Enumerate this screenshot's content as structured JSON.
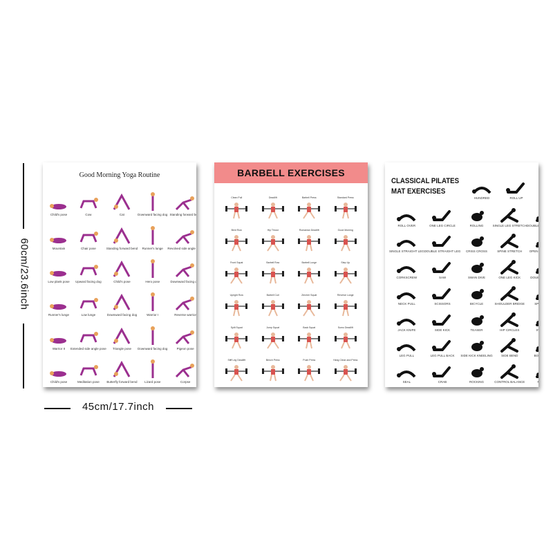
{
  "dimensions": {
    "height_label": "60cm/23.6inch",
    "width_label": "45cm/17.7inch"
  },
  "colors": {
    "yoga_accent": "#9b2f8f",
    "yoga_skin": "#e8a15a",
    "barbell_banner": "#f28b8b",
    "barbell_figure": "#d9534f",
    "pilates_silhouette": "#111111"
  },
  "posters": {
    "yoga": {
      "title": "Good Morning Yoga Routine",
      "rows": [
        [
          "Child's pose",
          "Cow",
          "Cat",
          "Downward facing dog",
          "Standing forward bend"
        ],
        [
          "Mountain",
          "Chair pose",
          "Standing forward bend",
          "Runner's lunge",
          "Revolved side angle pose"
        ],
        [
          "Low plank pose",
          "Upward facing dog",
          "Child's pose",
          "Hero pose",
          "Downward facing dog"
        ],
        [
          "Runner's lunge",
          "Low lunge",
          "Downward facing dog",
          "Warrior I",
          "Reverse warrior"
        ],
        [
          "Warrior II",
          "Extended side angle pose",
          "Triangle pose",
          "Downward facing dog",
          "Pigeon pose"
        ],
        [
          "Child's pose",
          "Meditation pose",
          "Butterfly forward bend",
          "Lizard pose",
          "Corpse"
        ]
      ]
    },
    "barbell": {
      "title": "BARBELL EXERCISES",
      "rows": [
        [
          "Clean Pull",
          "Deadlift",
          "Barbell Press",
          "Standard Press"
        ],
        [
          "Bent Row",
          "Hip Thrust",
          "Romanian Deadlift",
          "Good Morning"
        ],
        [
          "Front Squat",
          "Barbell Row",
          "Barbell Lunge",
          "Step Up"
        ],
        [
          "Upright Row",
          "Barbell Curl",
          "Zercher Squat",
          "Reverse Lunge"
        ],
        [
          "Split Squat",
          "Jump Squat",
          "Back Squat",
          "Sumo Deadlift"
        ],
        [
          "Stiff Leg Deadlift",
          "Bench Press",
          "Push Press",
          "Hang Clean and Press"
        ]
      ]
    },
    "pilates": {
      "title_line1": "CLASSICAL PILATES",
      "title_line2": "MAT EXERCISES",
      "top_row": [
        "HUNDRED",
        "ROLL UP"
      ],
      "rows": [
        [
          "ROLL OVER",
          "ONE LEG CIRCLE",
          "ROLLING",
          "SINGLE LEG STRETCH",
          "DOUBLE LEG STRETCH"
        ],
        [
          "SINGLE STRAIGHT LEG",
          "DOUBLE STRAIGHT LEG",
          "CRISS CROSS",
          "SPINE STRETCH",
          "OPEN LEG ROCKER"
        ],
        [
          "CORKSCREW",
          "SAW",
          "SWAN DIVE",
          "ONE LEG KICK",
          "DOUBLE LEG KICK"
        ],
        [
          "NECK PULL",
          "SCISSORS",
          "BICYCLE",
          "SHOULDER BRIDGE",
          "SPINE TWIST"
        ],
        [
          "JACK KNIFE",
          "SIDE KICK",
          "TEASER",
          "HIP CIRCLES",
          "SWIMMING"
        ],
        [
          "LEG PULL",
          "LEG PULL BACK",
          "SIDE KICK KNEELING",
          "SIDE BEND",
          "BOOMERANG"
        ],
        [
          "SEAL",
          "CRAB",
          "ROCKING",
          "CONTROL BALANCE",
          "PUSH UP"
        ]
      ]
    }
  }
}
